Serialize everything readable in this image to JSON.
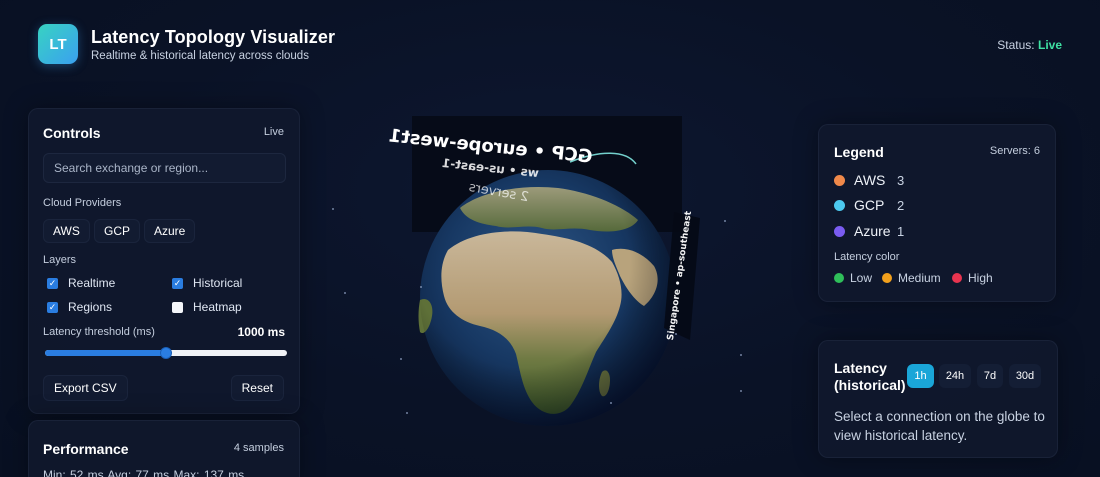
{
  "app": {
    "logo_text": "LT",
    "title": "Latency Topology Visualizer",
    "subtitle": "Realtime & historical latency across clouds",
    "status_label": "Status:",
    "status_value": "Live"
  },
  "controls": {
    "title": "Controls",
    "mode": "Live",
    "search_placeholder": "Search exchange or region...",
    "providers_label": "Cloud Providers",
    "providers": [
      "AWS",
      "GCP",
      "Azure"
    ],
    "layers_label": "Layers",
    "layers": [
      {
        "label": "Realtime",
        "checked": true
      },
      {
        "label": "Historical",
        "checked": true
      },
      {
        "label": "Regions",
        "checked": true
      },
      {
        "label": "Heatmap",
        "checked": false
      }
    ],
    "threshold_label": "Latency threshold (ms)",
    "threshold_value": "1000 ms",
    "threshold_fraction": 0.5,
    "export_label": "Export CSV",
    "reset_label": "Reset"
  },
  "performance": {
    "title": "Performance",
    "samples": "4 samples",
    "stats": "Min: 52 ms    Avg: 77 ms    Max: 137 ms"
  },
  "globe": {
    "label_main": "GCP • europe-west1",
    "label_secondary": "ws • us-east-1",
    "label_servers": "2 servers",
    "label_side": "Singapore • ap-southeast"
  },
  "legend": {
    "title": "Legend",
    "servers": "Servers: 6",
    "providers": [
      {
        "name": "AWS",
        "count": "3",
        "color": "#f0894a"
      },
      {
        "name": "GCP",
        "count": "2",
        "color": "#4cc9ef"
      },
      {
        "name": "Azure",
        "count": "1",
        "color": "#7a5cf0"
      }
    ],
    "latency_color_label": "Latency color",
    "latency_colors": [
      {
        "name": "Low",
        "color": "#2fbf5a"
      },
      {
        "name": "Medium",
        "color": "#f2a01c"
      },
      {
        "name": "High",
        "color": "#e8344f"
      }
    ]
  },
  "latency_panel": {
    "title_line1": "Latency",
    "title_line2": "(historical)",
    "ranges": [
      {
        "label": "1h",
        "active": true
      },
      {
        "label": "24h",
        "active": false
      },
      {
        "label": "7d",
        "active": false
      },
      {
        "label": "30d",
        "active": false
      }
    ],
    "help": "Select a connection on the globe to view historical latency."
  }
}
